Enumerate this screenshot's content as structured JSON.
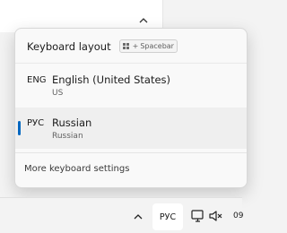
{
  "flyout": {
    "title": "Keyboard layout",
    "shortcut": {
      "plus": "+",
      "key": "Spacebar"
    },
    "languages": [
      {
        "code": "ENG",
        "name": "English (United States)",
        "layout": "US",
        "selected": false
      },
      {
        "code": "РУС",
        "name": "Russian",
        "layout": "Russian",
        "selected": true
      }
    ],
    "more_settings": "More keyboard settings"
  },
  "taskbar": {
    "language_indicator": "РУС",
    "clock_fragment": "09"
  },
  "colors": {
    "accent": "#0067c0",
    "flyout_bg": "#f9f9f9",
    "selected_bg": "#efefef"
  },
  "icons": [
    "chevron-up-icon",
    "windows-key-icon",
    "monitor-icon",
    "speaker-muted-icon"
  ]
}
